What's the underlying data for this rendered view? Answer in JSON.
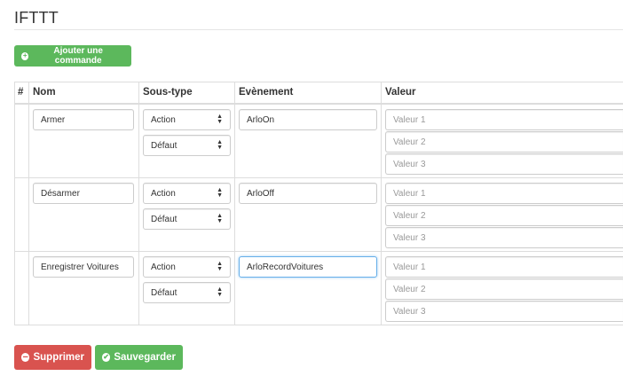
{
  "page": {
    "title": "IFTTT"
  },
  "toolbar": {
    "add_label": "Ajouter une commande"
  },
  "table": {
    "headers": [
      "#",
      "Nom",
      "Sous-type",
      "Evènement",
      "Valeur"
    ],
    "rows": [
      {
        "nom": "Armer",
        "subtype": "Action",
        "subtype2": "Défaut",
        "event": "ArloOn",
        "valeurs": [
          "Valeur 1",
          "Valeur 2",
          "Valeur 3"
        ]
      },
      {
        "nom": "Désarmer",
        "subtype": "Action",
        "subtype2": "Défaut",
        "event": "ArloOff",
        "valeurs": [
          "Valeur 1",
          "Valeur 2",
          "Valeur 3"
        ]
      },
      {
        "nom": "Enregistrer Voitures",
        "subtype": "Action",
        "subtype2": "Défaut",
        "event": "ArloRecordVoitures",
        "valeurs": [
          "Valeur 1",
          "Valeur 2",
          "Valeur 3"
        ]
      }
    ]
  },
  "footer": {
    "delete_label": "Supprimer",
    "save_label": "Sauvegarder"
  },
  "colors": {
    "success": "#5cb85c",
    "danger": "#d9534f",
    "focus": "#66afe9"
  }
}
